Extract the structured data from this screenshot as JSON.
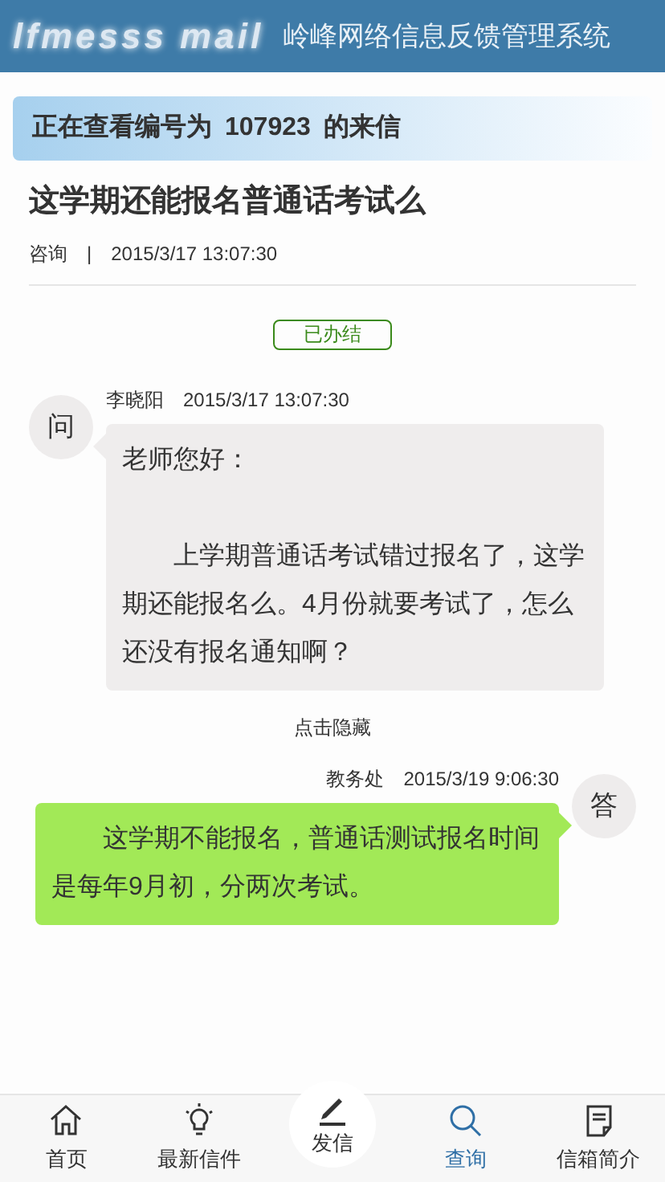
{
  "header": {
    "logo": "lfmesss mail",
    "title": "岭峰网络信息反馈管理系统"
  },
  "banner": {
    "prefix": "正在查看编号为",
    "number": "107923",
    "suffix": "的来信"
  },
  "letter": {
    "title": "这学期还能报名普通话考试么",
    "category": "咨询",
    "separator": "|",
    "time": "2015/3/17 13:07:30",
    "status": "已办结"
  },
  "messages": [
    {
      "kind": "question",
      "avatar": "问",
      "author": "李晓阳",
      "time": "2015/3/17 13:07:30",
      "paragraphs": [
        {
          "kind": "greeting",
          "text": "老师您好："
        },
        {
          "kind": "body",
          "text": "上学期普通话考试错过报名了，这学期还能报名么。4月份就要考试了，怎么还没有报名通知啊？"
        }
      ]
    },
    {
      "kind": "toggle",
      "label": "点击隐藏"
    },
    {
      "kind": "answer",
      "avatar": "答",
      "author": "教务处",
      "time": "2015/3/19 9:06:30",
      "paragraphs": [
        {
          "kind": "body",
          "text": "这学期不能报名，普通话测试报名时间是每年9月初，分两次考试。"
        }
      ]
    }
  ],
  "nav": [
    {
      "kind": "tab",
      "label": "首页",
      "selected": false
    },
    {
      "kind": "tab",
      "label": "最新信件",
      "selected": false
    },
    {
      "kind": "center",
      "label": "发信",
      "selected": false
    },
    {
      "kind": "tab",
      "label": "查询",
      "selected": true
    },
    {
      "kind": "tab",
      "label": "信箱简介",
      "selected": false
    }
  ]
}
